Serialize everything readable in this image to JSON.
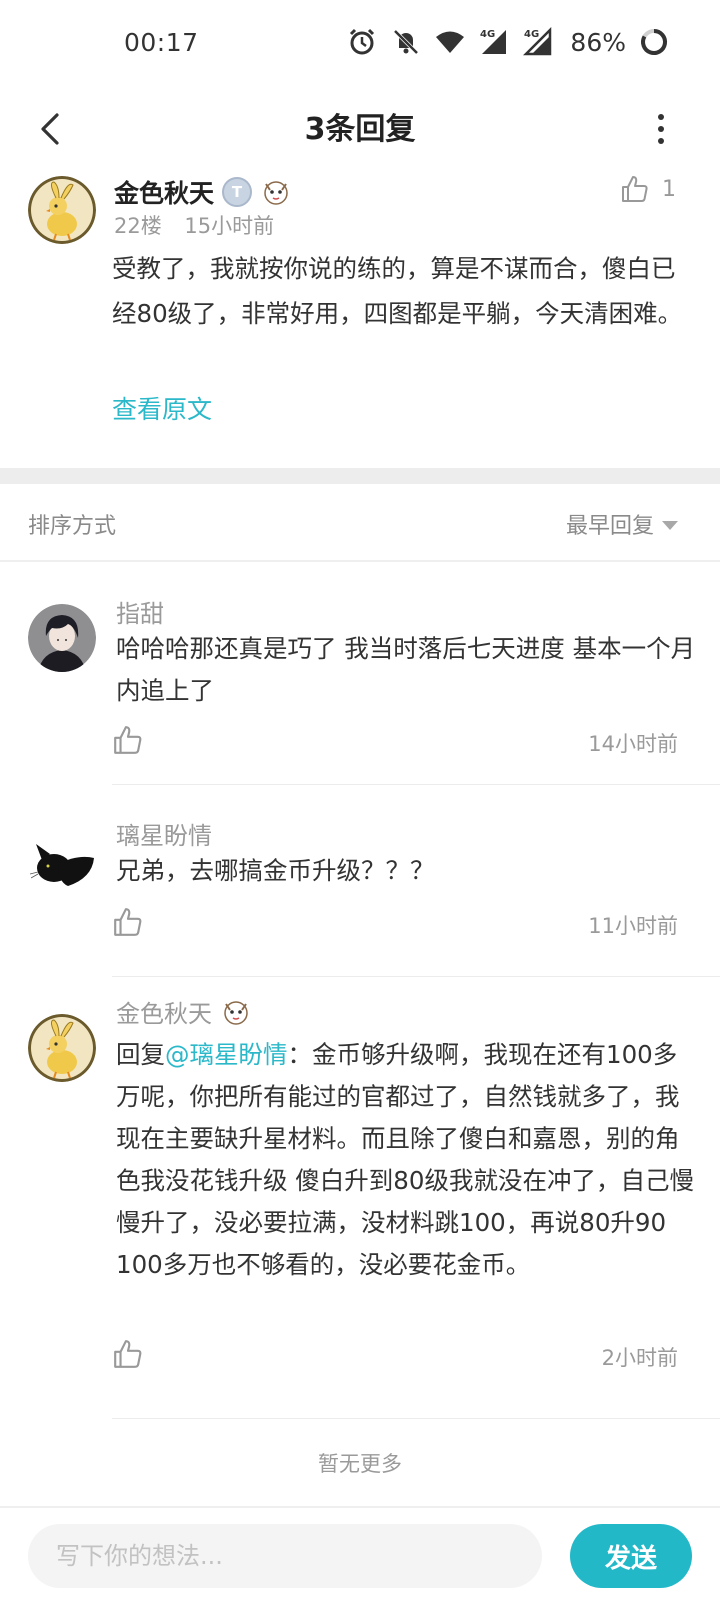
{
  "status_bar": {
    "time": "00:17",
    "battery": "86%",
    "icons": [
      "alarm-icon",
      "mute-icon",
      "wifi-icon",
      "signal-4g-icon",
      "signal-4g-icon",
      "battery-icon"
    ],
    "net_label": "4G"
  },
  "header": {
    "title": "3条回复",
    "back_icon": "chevron-left-icon",
    "more_icon": "more-vertical-icon"
  },
  "post": {
    "username": "金色秋天",
    "badge_text": "T",
    "floor": "22楼",
    "time": "15小时前",
    "like_count": "1",
    "content": "受教了，我就按你说的练的，算是不谋而合，傻白已经80级了，非常好用，四图都是平躺，今天清困难。",
    "view_original": "查看原文"
  },
  "sort": {
    "label": "排序方式",
    "selected": "最早回复"
  },
  "replies": [
    {
      "username": "指甜",
      "text": "哈哈哈那还真是巧了  我当时落后七天进度  基本一个月内追上了",
      "time": "14小时前"
    },
    {
      "username": "璃星盼情",
      "text": "兄弟，去哪搞金币升级？？？",
      "time": "11小时前"
    },
    {
      "username": "金色秋天",
      "reply_prefix": "回复",
      "mention": "@璃星盼情",
      "text": "：金币够升级啊，我现在还有100多万呢，你把所有能过的官都过了，自然钱就多了，我现在主要缺升星材料。而且除了傻白和嘉恩，别的角色我没花钱升级 傻白升到80级我就没在冲了，自己慢慢升了，没必要拉满，没材料跳100，再说80升90 100多万也不够看的，没必要花金币。",
      "time": "2小时前"
    }
  ],
  "no_more": "暂无更多",
  "composer": {
    "placeholder": "写下你的想法...",
    "send_label": "发送"
  },
  "colors": {
    "accent": "#22b8c8",
    "link": "#2bb8c9"
  }
}
